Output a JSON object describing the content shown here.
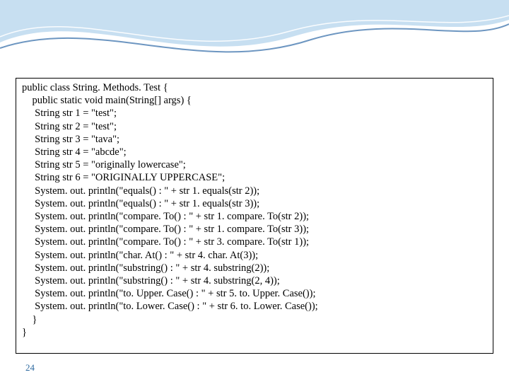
{
  "page_number": "24",
  "code": {
    "l0": "public class String. Methods. Test {",
    "l1": "    public static void main(String[] args) {",
    "l2": "     String str 1 = \"test\";",
    "l3": "     String str 2 = \"test\";",
    "l4": "     String str 3 = \"tava\";",
    "l5": "     String str 4 = \"abcde\";",
    "l6": "     String str 5 = \"originally lowercase\";",
    "l7": "     String str 6 = \"ORIGINALLY UPPERCASE\";",
    "l8": "     System. out. println(\"equals() : \" + str 1. equals(str 2));",
    "l9": "     System. out. println(\"equals() : \" + str 1. equals(str 3));",
    "l10": "     System. out. println(\"compare. To() : \" + str 1. compare. To(str 2));",
    "l11": "     System. out. println(\"compare. To() : \" + str 1. compare. To(str 3));",
    "l12": "     System. out. println(\"compare. To() : \" + str 3. compare. To(str 1));",
    "l13": "     System. out. println(\"char. At() : \" + str 4. char. At(3));",
    "l14": "     System. out. println(\"substring() : \" + str 4. substring(2));",
    "l15": "     System. out. println(\"substring() : \" + str 4. substring(2, 4));",
    "l16": "     System. out. println(\"to. Upper. Case() : \" + str 5. to. Upper. Case());",
    "l17": "     System. out. println(\"to. Lower. Case() : \" + str 6. to. Lower. Case());",
    "l18": "    }",
    "l19": "}"
  }
}
